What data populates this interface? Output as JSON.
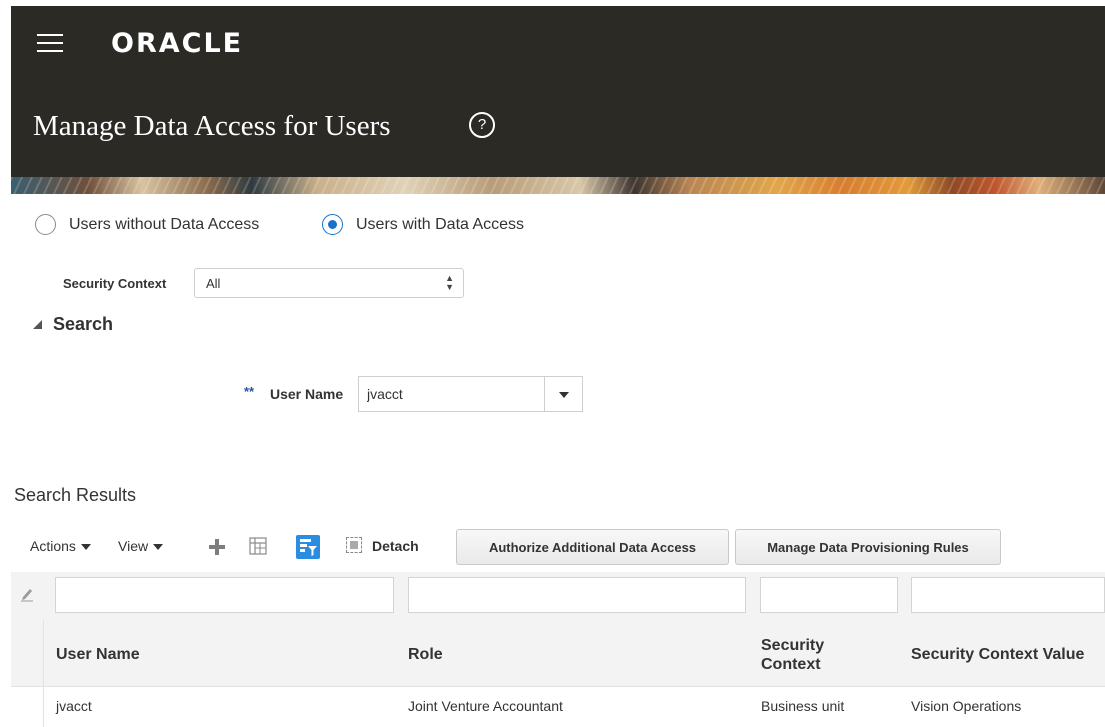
{
  "header": {
    "logo": "ORACLE",
    "page_title": "Manage Data Access for Users",
    "help_icon": "help-circle-icon",
    "help_glyph": "?"
  },
  "access_filter": {
    "options": [
      {
        "label": "Users without Data Access",
        "selected": false
      },
      {
        "label": "Users with Data Access",
        "selected": true
      }
    ]
  },
  "security_context": {
    "label": "Security Context",
    "value": "All"
  },
  "search": {
    "title": "Search",
    "required_marker": "**",
    "user_name_label": "User Name",
    "user_name_value": "jvacct"
  },
  "results": {
    "title": "Search Results",
    "toolbar": {
      "actions_label": "Actions",
      "view_label": "View",
      "detach_label": "Detach",
      "authorize_button": "Authorize Additional Data Access",
      "rules_button": "Manage Data Provisioning Rules"
    },
    "columns": [
      "User Name",
      "Role",
      "Security Context",
      "Security Context Value"
    ],
    "rows": [
      {
        "user_name": "jvacct",
        "role": "Joint Venture Accountant",
        "security_context": "Business unit",
        "security_context_value": "Vision Operations"
      }
    ]
  },
  "colors": {
    "header_bg": "#2b2a25",
    "accent_blue": "#1a73c7",
    "filter_button_blue": "#2a8de0"
  }
}
